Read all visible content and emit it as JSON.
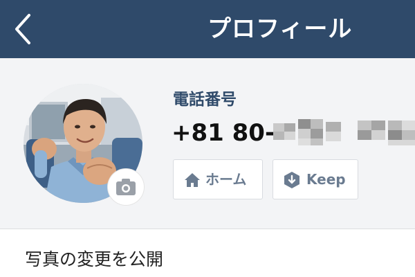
{
  "header": {
    "title": "プロフィール",
    "back_icon": "chevron-left-icon",
    "background": "#2f4a6a"
  },
  "profile": {
    "avatar_alt": "profile photo",
    "camera_icon": "camera-icon",
    "phone_label": "電話番号",
    "phone_number_visible": "+81 80-",
    "phone_number_rest": "pixelated / hidden",
    "buttons": {
      "home_label": "ホーム",
      "home_icon": "home-icon",
      "keep_label": "Keep",
      "keep_icon": "keep-download-icon"
    }
  },
  "settings": {
    "share_photo_change_label": "写真の変更を公開"
  },
  "colors": {
    "accent": "#2f4a6a",
    "button_text": "#6a7b90",
    "panel_bg": "#f3f4f6"
  }
}
